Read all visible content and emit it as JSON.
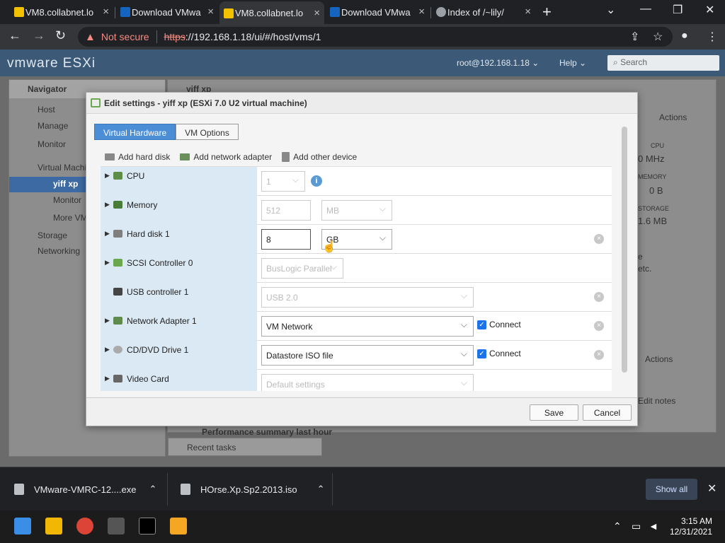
{
  "browser": {
    "tabs": [
      {
        "title": "VM8.collabnet.lo",
        "active": false,
        "favicon": "collabnet-icon"
      },
      {
        "title": "Download VMwa",
        "active": false,
        "favicon": "vmware-icon"
      },
      {
        "title": "VM8.collabnet.lo",
        "active": true,
        "favicon": "collabnet-icon"
      },
      {
        "title": "Download VMwa",
        "active": false,
        "favicon": "vmware-icon"
      },
      {
        "title": "Index of /~lily/",
        "active": false,
        "favicon": "settings-icon"
      }
    ],
    "not_secure": "Not secure",
    "url_scheme": "https",
    "url_rest": "://192.168.1.18/ui/#/host/vms/1"
  },
  "esxi": {
    "logo": "vmware ESXi",
    "user": "root@192.168.1.18 ⌄",
    "help": "Help ⌄",
    "search_placeholder": "Search"
  },
  "navigator": {
    "title": "Navigator",
    "host": "Host",
    "manage": "Manage",
    "monitor": "Monitor",
    "virtual_machines": "Virtual Machines",
    "vm_name": "yiff xp",
    "vm_monitor": "Monitor",
    "more_vms": "More VMs...",
    "storage": "Storage",
    "networking": "Networking"
  },
  "main_bg": {
    "vm_title": "yiff xp",
    "actions": "Actions",
    "cpu": "CPU",
    "cpu_val": "0 MHz",
    "memory": "MEMORY",
    "memory_val": "0 B",
    "storage": "STORAGE",
    "storage_val": "1.6 MB",
    "notice_line1": "e",
    "notice_line2": "etc.",
    "actions2": "Actions",
    "edit_notes": "Edit notes",
    "perf": "Performance summary last hour",
    "recent_tasks": "Recent tasks"
  },
  "modal": {
    "title": "Edit settings - yiff xp (ESXi 7.0 U2 virtual machine)",
    "tabs": [
      "Virtual Hardware",
      "VM Options"
    ],
    "add_hard_disk": "Add hard disk",
    "add_network_adapter": "Add network adapter",
    "add_other_device": "Add other device",
    "rows": [
      {
        "label": "CPU",
        "v1": "1",
        "v2": ""
      },
      {
        "label": "Memory",
        "v1": "512",
        "v2": "MB"
      },
      {
        "label": "Hard disk 1",
        "v1": "8",
        "v2": "GB"
      },
      {
        "label": "SCSI Controller 0",
        "v1": "BusLogic Parallel",
        "v2": ""
      },
      {
        "label": "USB controller 1",
        "v1": "USB 2.0",
        "v2": ""
      },
      {
        "label": "Network Adapter 1",
        "v1": "VM Network",
        "v2": "Connect"
      },
      {
        "label": "CD/DVD Drive 1",
        "v1": "Datastore ISO file",
        "v2": "Connect"
      },
      {
        "label": "Video Card",
        "v1": "Default settings",
        "v2": ""
      }
    ],
    "info_icon": "i",
    "remove_glyph": "×",
    "check_glyph": "✓",
    "save": "Save",
    "cancel": "Cancel"
  },
  "downloads": [
    {
      "name": "VMware-VMRC-12....exe"
    },
    {
      "name": "HOrse.Xp.Sp2.2013.iso"
    }
  ],
  "show_all": "Show all",
  "clock": {
    "time": "3:15 AM",
    "date": "12/31/2021"
  }
}
